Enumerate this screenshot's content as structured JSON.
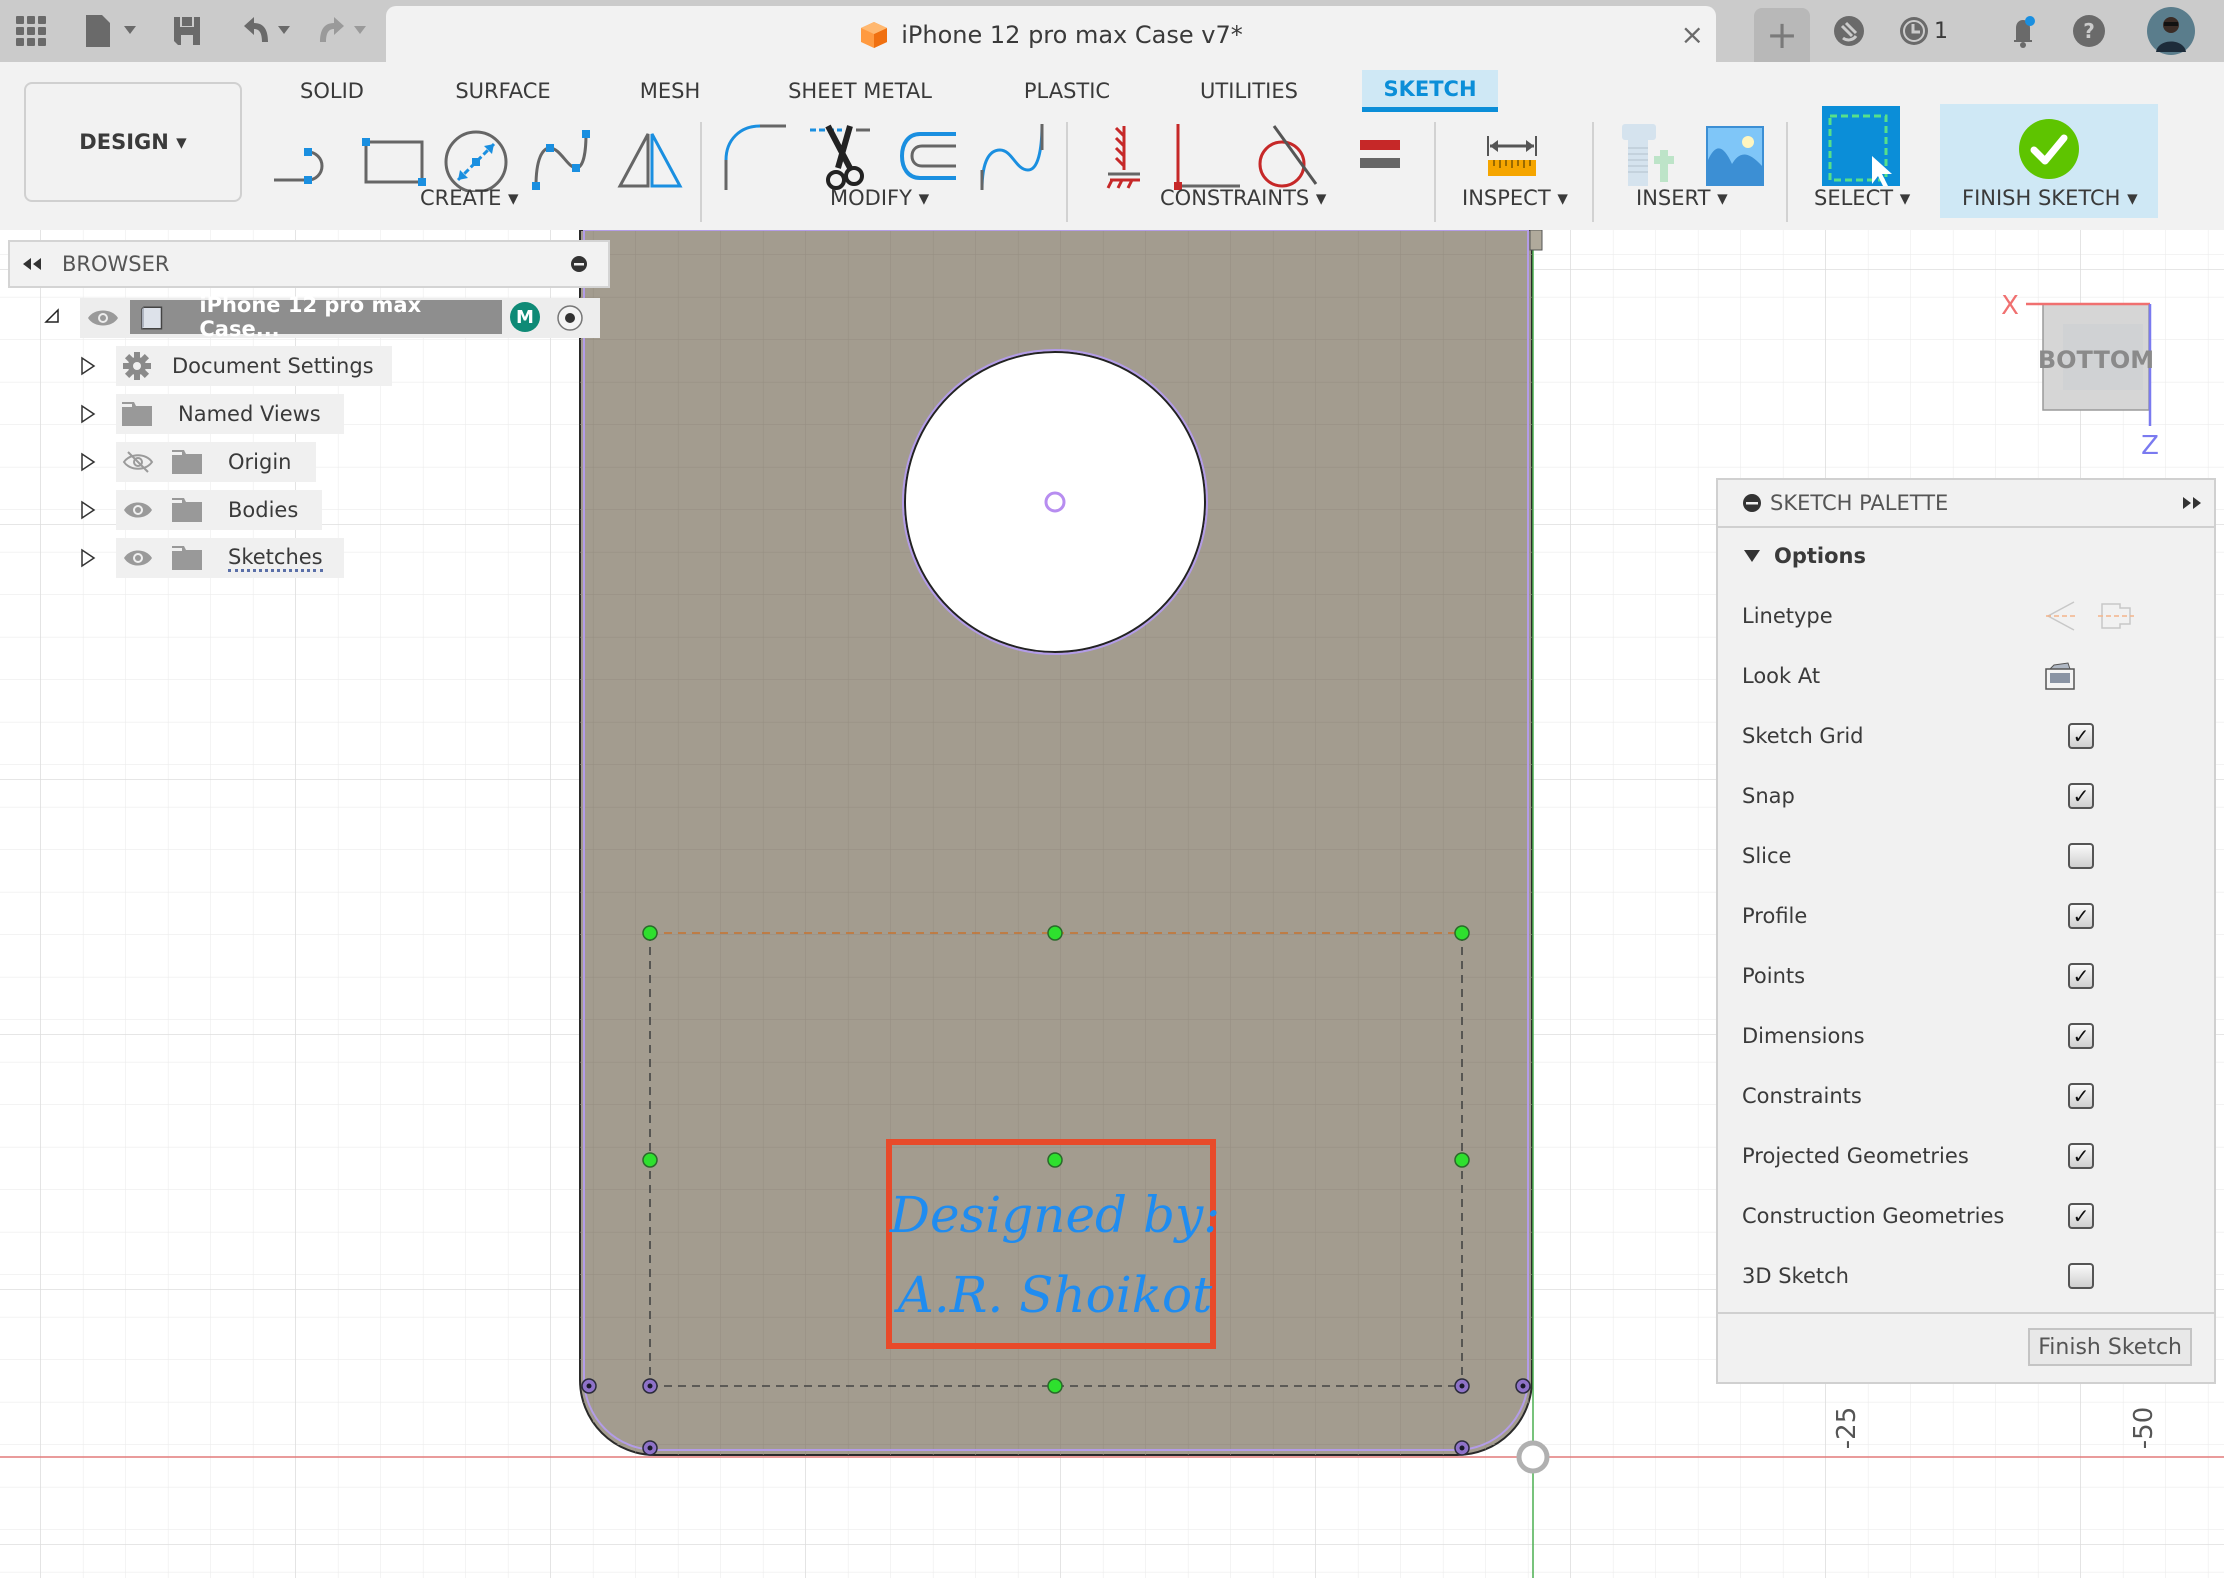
{
  "titlebar": {
    "doc_title": "iPhone 12 pro max Case v7*",
    "close_glyph": "×",
    "new_tab_glyph": "+",
    "job_count": "1",
    "icons": [
      "apps-grid-icon",
      "file-icon",
      "save-icon",
      "undo-icon",
      "redo-icon",
      "offline-icon",
      "job-status-icon",
      "notifications-icon",
      "help-icon",
      "user-avatar"
    ]
  },
  "ribbon": {
    "workspace": "DESIGN ▾",
    "tabs": [
      {
        "label": "SOLID",
        "active": false
      },
      {
        "label": "SURFACE",
        "active": false
      },
      {
        "label": "MESH",
        "active": false
      },
      {
        "label": "SHEET METAL",
        "active": false
      },
      {
        "label": "PLASTIC",
        "active": false
      },
      {
        "label": "UTILITIES",
        "active": false
      },
      {
        "label": "SKETCH",
        "active": true
      }
    ],
    "groups": {
      "create": "CREATE ▾",
      "modify": "MODIFY ▾",
      "constraints": "CONSTRAINTS ▾",
      "inspect": "INSPECT ▾",
      "insert": "INSERT ▾",
      "select": "SELECT ▾",
      "finish": "FINISH SKETCH ▾"
    },
    "tools": {
      "create": [
        "line-icon",
        "rectangle-icon",
        "circle-icon",
        "spline-icon",
        "mirror-icon"
      ],
      "modify": [
        "fillet-icon",
        "trim-icon",
        "offset-icon",
        "spline-edit-icon"
      ],
      "constraints": [
        "fix-icon",
        "coincident-icon",
        "tangent-icon",
        "equal-icon"
      ],
      "inspect": [
        "measure-icon"
      ],
      "insert": [
        "insert-mcmaster-icon",
        "insert-canvas-icon"
      ],
      "select": [
        "select-window-icon"
      ],
      "finish": [
        "finish-sketch-check-icon"
      ]
    },
    "accent": "#0b8ed8"
  },
  "browser": {
    "title": "BROWSER",
    "root": {
      "label": "iPhone 12 pro max Case...",
      "badge": "M"
    },
    "items": [
      {
        "label": "Document Settings",
        "icon": "gear-icon",
        "eye": "none"
      },
      {
        "label": "Named Views",
        "icon": "folder-icon",
        "eye": "none"
      },
      {
        "label": "Origin",
        "icon": "folder-icon",
        "eye": "hidden"
      },
      {
        "label": "Bodies",
        "icon": "folder-icon",
        "eye": "visible"
      },
      {
        "label": "Sketches",
        "icon": "folder-icon",
        "eye": "visible"
      }
    ]
  },
  "viewcube": {
    "face": "BOTTOM",
    "x_axis": "X",
    "z_axis": "Z"
  },
  "sketch": {
    "text_line1": "Designed by:",
    "text_line2": "A.R. Shoikot",
    "text_color": "#1f8cf0",
    "frame_color": "#e84a2a",
    "body_color": "#a39c8f"
  },
  "axis_labels": [
    "-25",
    "-50"
  ],
  "palette": {
    "title": "SKETCH PALETTE",
    "section": "Options",
    "rows": [
      {
        "label": "Linetype",
        "type": "icons"
      },
      {
        "label": "Look At",
        "type": "icon"
      },
      {
        "label": "Sketch Grid",
        "type": "checkbox",
        "checked": true
      },
      {
        "label": "Snap",
        "type": "checkbox",
        "checked": true
      },
      {
        "label": "Slice",
        "type": "checkbox",
        "checked": false
      },
      {
        "label": "Profile",
        "type": "checkbox",
        "checked": true
      },
      {
        "label": "Points",
        "type": "checkbox",
        "checked": true
      },
      {
        "label": "Dimensions",
        "type": "checkbox",
        "checked": true
      },
      {
        "label": "Constraints",
        "type": "checkbox",
        "checked": true
      },
      {
        "label": "Projected Geometries",
        "type": "checkbox",
        "checked": true
      },
      {
        "label": "Construction Geometries",
        "type": "checkbox",
        "checked": true
      },
      {
        "label": "3D Sketch",
        "type": "checkbox",
        "checked": false
      }
    ],
    "finish_button": "Finish Sketch"
  }
}
